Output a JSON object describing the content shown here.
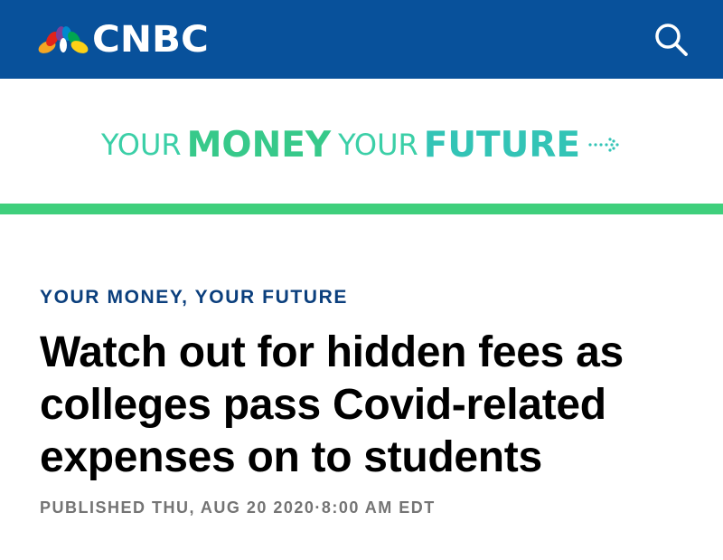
{
  "header": {
    "brand": "CNBC",
    "logo_icon": "peacock-icon",
    "search_icon": "search-icon",
    "background_color": "#08519b"
  },
  "banner": {
    "word1": "YOUR",
    "word2": "MONEY",
    "word3": "YOUR",
    "word4": "FUTURE",
    "arrow_icon": "dotted-arrow-icon",
    "accent_color": "#3fcf7c"
  },
  "article": {
    "section": "YOUR MONEY, YOUR FUTURE",
    "headline": "Watch out for hidden fees as colleges pass Covid-related expenses on to students",
    "published": "PUBLISHED THU, AUG 20 2020·8:00 AM EDT"
  }
}
